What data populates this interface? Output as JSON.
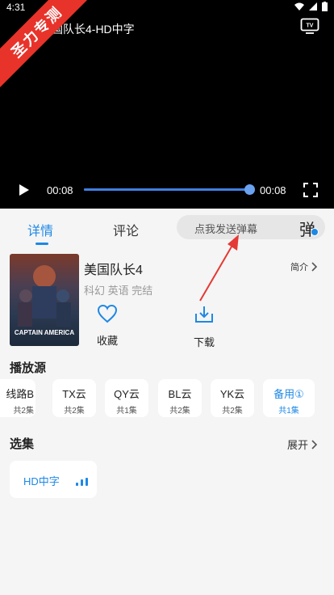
{
  "status": {
    "time": "4:31"
  },
  "ribbon": {
    "text": "圣力专测"
  },
  "player": {
    "title": "国队长4-HD中字",
    "current_time": "00:08",
    "total_time": "00:08",
    "progress": 0.98
  },
  "tabs": {
    "details": "详情",
    "comments": "评论"
  },
  "danmaku": {
    "placeholder": "点我发送弹幕",
    "icon_char": "弹"
  },
  "movie": {
    "title": "美国队长4",
    "meta": "科幻 英语 完结",
    "intro": "简介",
    "poster_text": "CAPTAIN AMERICA",
    "favorite": "收藏",
    "download": "下载"
  },
  "sources": {
    "title": "播放源",
    "items": [
      {
        "name": "线路B",
        "count": "共2集"
      },
      {
        "name": "TX云",
        "count": "共2集"
      },
      {
        "name": "QY云",
        "count": "共1集"
      },
      {
        "name": "BL云",
        "count": "共2集"
      },
      {
        "name": "YK云",
        "count": "共2集"
      },
      {
        "name": "备用①",
        "count": "共1集"
      }
    ]
  },
  "episodes": {
    "title": "选集",
    "expand": "展开",
    "items": [
      {
        "label": "HD中字"
      }
    ]
  },
  "colors": {
    "accent": "#1e88e5",
    "ribbon": "#e8332a",
    "annotation_arrow": "#e53935"
  }
}
